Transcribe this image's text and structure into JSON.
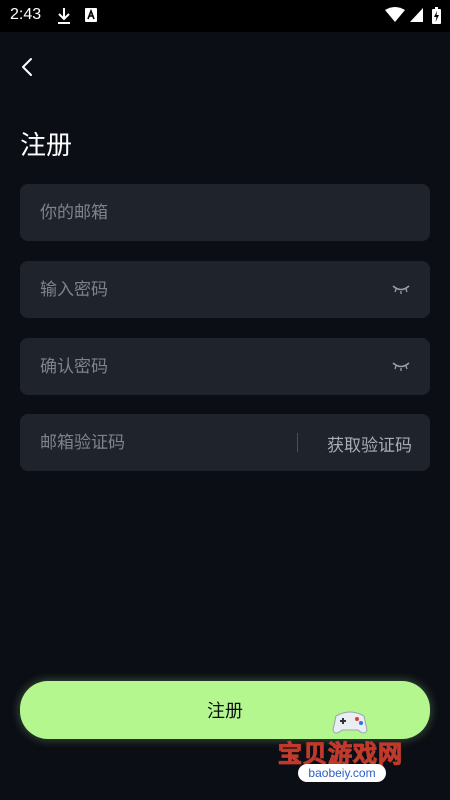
{
  "status_bar": {
    "time": "2:43"
  },
  "header": {
    "title": "注册"
  },
  "form": {
    "email_placeholder": "你的邮箱",
    "password_placeholder": "输入密码",
    "confirm_placeholder": "确认密码",
    "code_placeholder": "邮箱验证码",
    "get_code_label": "获取验证码"
  },
  "submit": {
    "label": "注册"
  },
  "watermark": {
    "text": "宝贝游戏网",
    "url": "baobeiy.com"
  },
  "colors": {
    "background": "#0b0e15",
    "field": "#1f242c",
    "accent": "#b5f78f"
  }
}
